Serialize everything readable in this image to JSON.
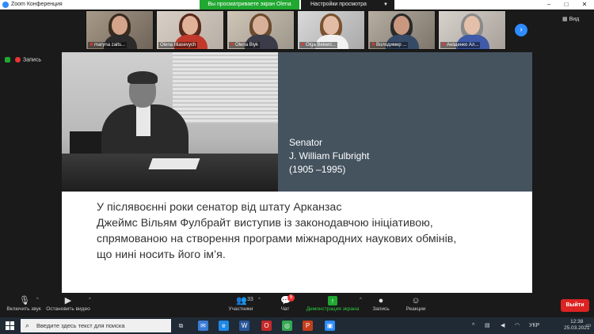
{
  "window": {
    "title": "Zoom Конференция",
    "share_banner": "Вы просматриваете экран Olena Illiasevych",
    "view_options": "Настройки просмотра",
    "controls": [
      "–",
      "□",
      "✕"
    ]
  },
  "gallery": {
    "view_label": "Вид",
    "participants": [
      {
        "name": "maryna zaits...",
        "muted": true
      },
      {
        "name": "Olena Illiasevych",
        "muted": false
      },
      {
        "name": "Olena Biyk",
        "muted": true
      },
      {
        "name": "Olga Bekeni...",
        "muted": true
      },
      {
        "name": "Володимир ...",
        "muted": true
      },
      {
        "name": "Аніщенко Ал...",
        "muted": true
      }
    ]
  },
  "status": {
    "recording_label": "Запись"
  },
  "slide": {
    "caption": [
      "Senator",
      "J. William Fulbright",
      "(1905 –1995)"
    ],
    "body": [
      "У післявоєнні роки сенатор від штату Арканзас",
      "Джеймс Вільям Фулбрайт виступив із законодавчою ініціативою,",
      "спрямованою на створення програми міжнародних наукових обмінів,",
      "що нині носить його ім’я."
    ]
  },
  "meeting_controls": {
    "unmute": "Включить звук",
    "stop_video": "Остановить видео",
    "participants": "Участники",
    "participants_count": "33",
    "chat": "Чат",
    "chat_badge": "5",
    "share_screen": "Демонстрация экрана",
    "record": "Запись",
    "reactions": "Реакции",
    "leave": "Выйти"
  },
  "taskbar": {
    "search_placeholder": "Введите здесь текст для поиска",
    "language": "УКР",
    "time": "12:38",
    "date": "25.03.2021"
  },
  "colors": {
    "accent": "#2d8cff",
    "share_green": "#20a830",
    "leave_red": "#dd2222",
    "caption_panel": "#45535f"
  }
}
